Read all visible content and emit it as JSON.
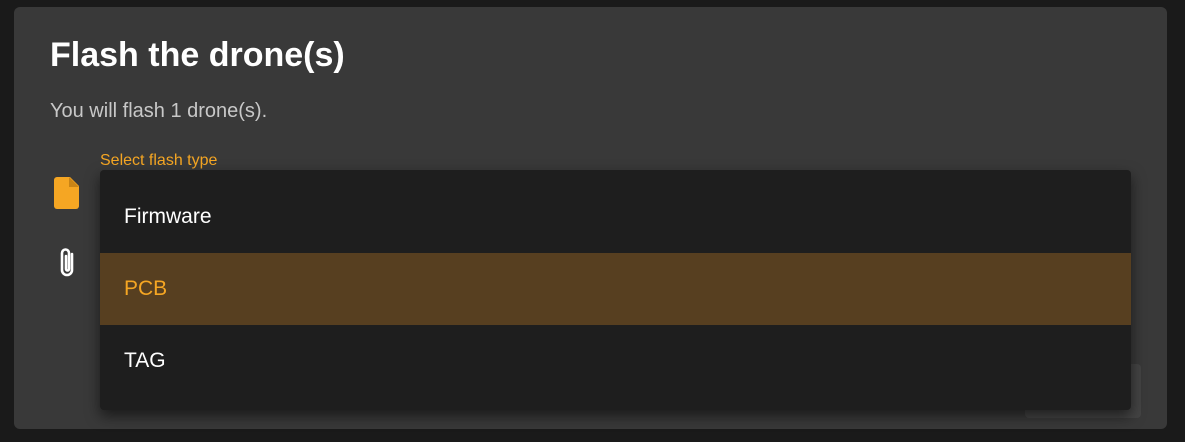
{
  "dialog": {
    "title": "Flash the drone(s)",
    "subtitle": "You will flash 1 drone(s)."
  },
  "select": {
    "label": "Select flash type",
    "options": [
      {
        "label": "Firmware",
        "selected": false
      },
      {
        "label": "PCB",
        "selected": true
      },
      {
        "label": "TAG",
        "selected": false
      }
    ]
  },
  "icons": {
    "file": "file-icon",
    "attachment": "paperclip-icon"
  },
  "colors": {
    "accent": "#f5a623",
    "dialog_bg": "#393939",
    "menu_bg": "#1e1e1e",
    "selected_bg": "#573f20"
  }
}
